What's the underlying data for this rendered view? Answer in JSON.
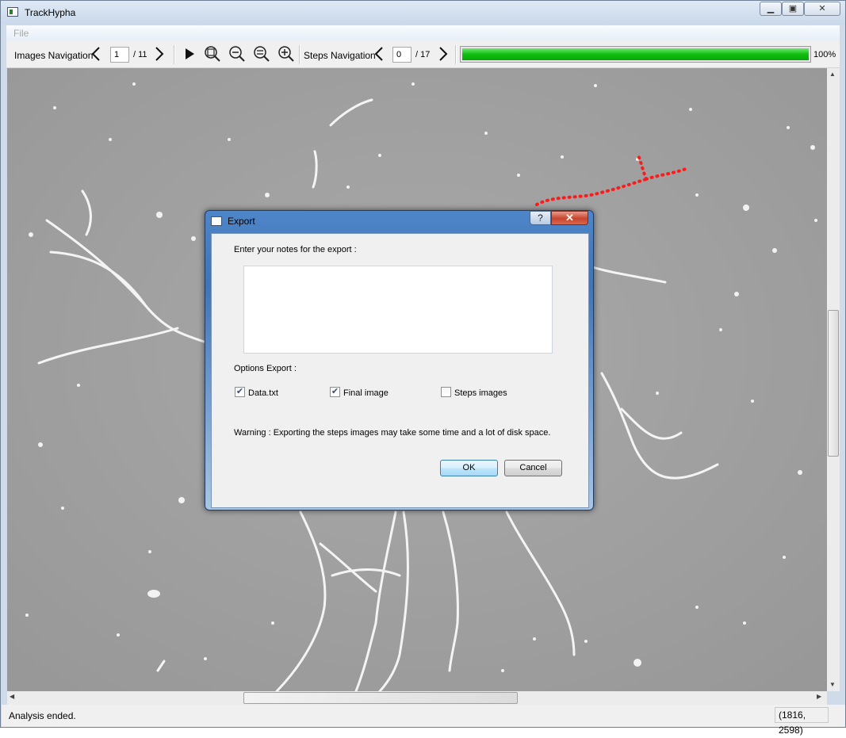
{
  "window": {
    "title": "TrackHypha"
  },
  "menu": {
    "file": "File"
  },
  "toolbar": {
    "images_nav_label": "Images Navigation",
    "image_current": "1",
    "image_total": "/ 11",
    "steps_nav_label": "Steps Navigation",
    "step_current": "0",
    "step_total": "/ 17",
    "progress_value": 100,
    "progress_text": "100%",
    "icons": [
      "chevron-left-icon",
      "chevron-right-icon",
      "play-icon",
      "zoom-fit-icon",
      "zoom-out-icon",
      "zoom-reset-icon",
      "zoom-in-icon"
    ]
  },
  "status": {
    "message": "Analysis ended.",
    "coords": "(1816, 2598)"
  },
  "dialog": {
    "title": "Export",
    "help": "?",
    "notes_label": "Enter your notes for the export :",
    "notes_value": "",
    "options_label": "Options Export :",
    "options": [
      {
        "label": "Data.txt",
        "checked": true
      },
      {
        "label": "Final image",
        "checked": true
      },
      {
        "label": "Steps images",
        "checked": false
      }
    ],
    "warning": "Warning : Exporting the steps images may take some time and a lot of disk space.",
    "ok_label": "OK",
    "cancel_label": "Cancel"
  },
  "colors": {
    "progress": "#0fbf0f",
    "trace": "#ff0000",
    "background_image": "#9d9d9d"
  }
}
